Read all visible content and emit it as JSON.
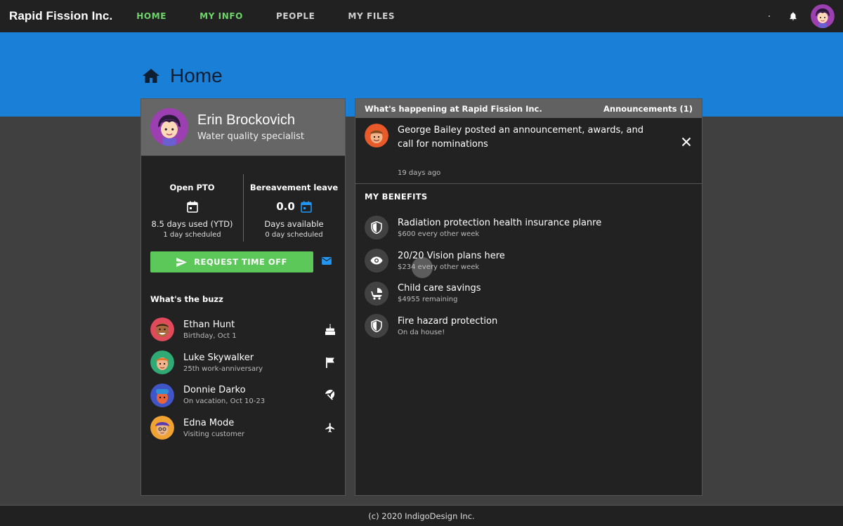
{
  "app": {
    "brand": "Rapid Fission Inc."
  },
  "nav": [
    {
      "label": "HOME",
      "active": true
    },
    {
      "label": "MY INFO",
      "active": true
    },
    {
      "label": "PEOPLE",
      "active": false
    },
    {
      "label": "MY FILES",
      "active": false
    }
  ],
  "page": {
    "title": "Home",
    "icon": "home-icon"
  },
  "profile": {
    "name": "Erin Brockovich",
    "role": "Water quality specialist"
  },
  "pto": {
    "open": {
      "title": "Open PTO",
      "line1": "8.5 days used (YTD)",
      "line2": "1 day scheduled",
      "icon": "calendar-icon"
    },
    "bereavement": {
      "title": "Bereavement leave",
      "value": "0.0",
      "line1": "Days available",
      "line2": "0 day scheduled",
      "icon": "calendar-icon"
    }
  },
  "request_button": {
    "label": "REQUEST TIME OFF",
    "icon": "send-icon"
  },
  "buzz": {
    "title": "What's the buzz",
    "items": [
      {
        "name": "Ethan Hunt",
        "sub": "Birthday, Oct 1",
        "icon": "cake-icon"
      },
      {
        "name": "Luke Skywalker",
        "sub": "25th work-anniversary",
        "icon": "flag-icon"
      },
      {
        "name": "Donnie Darko",
        "sub": "On vacation, Oct 10-23",
        "icon": "beach-umbrella-icon"
      },
      {
        "name": "Edna Mode",
        "sub": "Visiting customer",
        "icon": "airplane-icon"
      }
    ]
  },
  "happening": {
    "title": "What's happening at Rapid Fission Inc.",
    "announcements": "Announcements (1)",
    "item": {
      "text": "George Bailey posted an announcement, awards, and call for nominations",
      "time": "19 days ago"
    }
  },
  "benefits": {
    "title": "MY BENEFITS",
    "items": [
      {
        "name": "Radiation protection health insurance planre",
        "sub": "$600 every other week",
        "icon": "shield-icon"
      },
      {
        "name": "20/20 Vision plans here",
        "sub": "$234 every other week",
        "icon": "eye-icon"
      },
      {
        "name": "Child care savings",
        "sub": "$4955 remaining",
        "icon": "stroller-icon"
      },
      {
        "name": "Fire hazard protection",
        "sub": "On da house!",
        "icon": "shield-icon"
      }
    ]
  },
  "footer": {
    "text": "(c) 2020 IndigoDesign Inc."
  },
  "colors": {
    "accent_green": "#5cc85a",
    "nav_active": "#6ed46a",
    "brand_blue": "#1a7fd6",
    "icon_blue": "#2196f3"
  }
}
